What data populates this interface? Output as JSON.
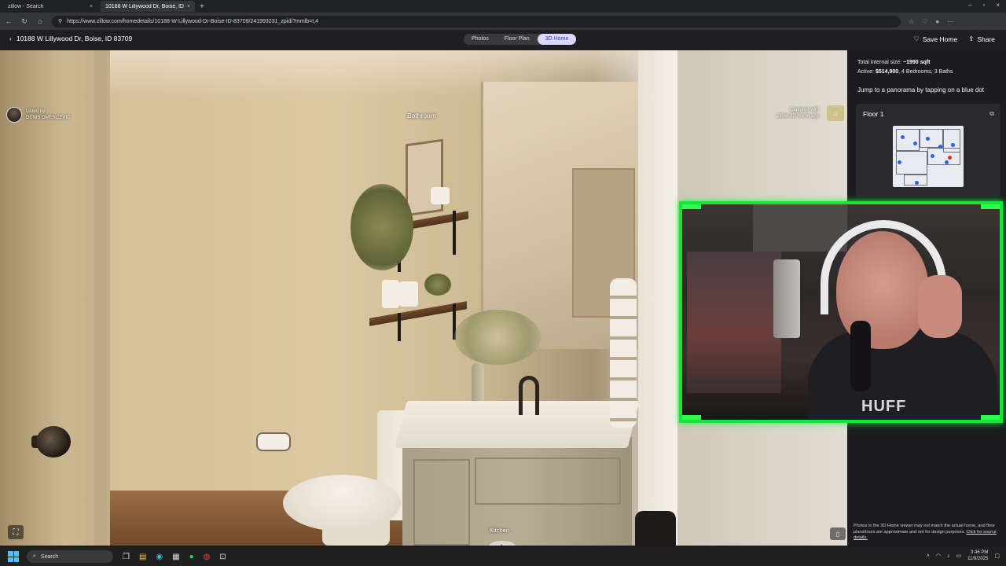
{
  "browser": {
    "tabs": [
      {
        "title": "zillow - Search",
        "close": "×"
      },
      {
        "title": "10188 W Lillywood Dr, Boise, ID 8...",
        "close": "×"
      }
    ],
    "new_tab": "+",
    "url": "https://www.zillow.com/homedetails/10188-W-Lillywood-Dr-Boise-ID-83709/241993231_zpid/?mmlb=t,4",
    "window_controls": {
      "minimize": "–",
      "maximize": "▫",
      "close": "×"
    }
  },
  "header": {
    "back_label": "10188 W Lillywood Dr, Boise, ID 83709",
    "tabs": [
      {
        "label": "Photos",
        "active": false
      },
      {
        "label": "Floor Plan",
        "active": false
      },
      {
        "label": "3D Home",
        "active": true
      }
    ],
    "save_label": "Save Home",
    "share_label": "Share"
  },
  "viewer": {
    "room_label": "Bathroom",
    "listed_by_label": "Listed by",
    "listed_by_name": "DENIS OMERCEVIC",
    "captured_with": "Captured with",
    "captured_app": "Zillow 3D Home app",
    "hotspot_label": "Kitchen",
    "hotspot_arrow": ">"
  },
  "panel": {
    "total_size_label": "Total internal size:",
    "total_size_value": "~1990 sqft",
    "active_label": "Active:",
    "price": "$514,900",
    "beds_baths": ", 4 Bedrooms, 3 Baths",
    "jump_text": "Jump to a panorama by tapping on a blue dot",
    "floor_title": "Floor 1",
    "disclaimer": "Photos in the 3D Home viewer may not match the actual home, and floor plans/tours are approximate and not for design purposes.",
    "disclaimer_link": "Click for source details."
  },
  "webcam": {
    "shirt_text": "HUFF"
  },
  "taskbar": {
    "search_label": "Search",
    "time": "3:46 PM",
    "date": "11/9/2025"
  },
  "colors": {
    "accent_tab_bg": "#d9d9ff",
    "accent_tab_text": "#3b3bb5",
    "webcam_border": "#19e23a",
    "floorplan_dot": "#2a62e8",
    "floorplan_current_dot": "#e22b2b"
  }
}
